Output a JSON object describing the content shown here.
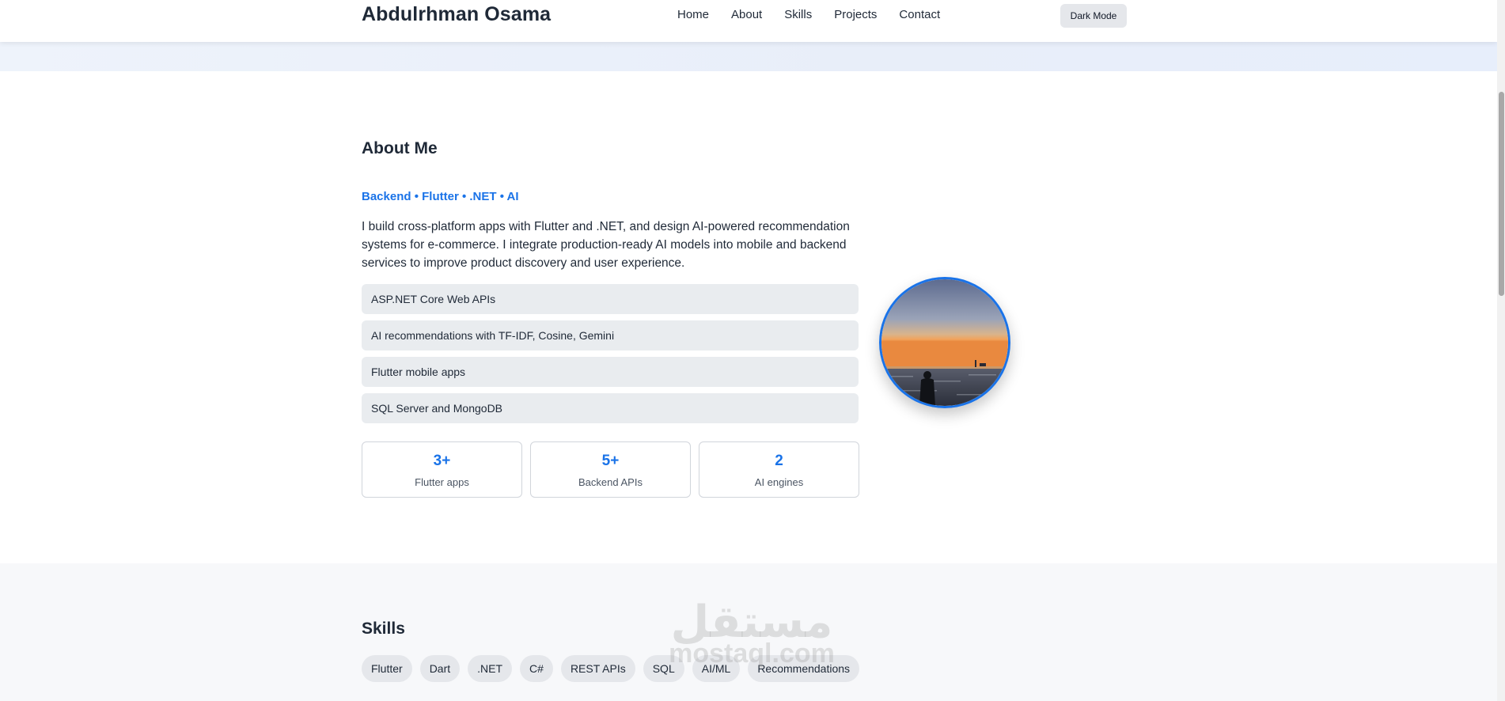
{
  "header": {
    "brand": "Abdulrhman Osama",
    "nav": [
      "Home",
      "About",
      "Skills",
      "Projects",
      "Contact"
    ],
    "theme_toggle": "Dark Mode"
  },
  "about": {
    "title": "About Me",
    "tagline": "Backend • Flutter • .NET • AI",
    "bio": "I build cross-platform apps with Flutter and .NET, and design AI-powered recommendation systems for e-commerce. I integrate production-ready AI models into mobile and backend services to improve product discovery and user experience.",
    "highlights": [
      "ASP.NET Core Web APIs",
      "AI recommendations with TF-IDF, Cosine, Gemini",
      "Flutter mobile apps",
      "SQL Server and MongoDB"
    ],
    "stats": [
      {
        "value": "3+",
        "label": "Flutter apps"
      },
      {
        "value": "5+",
        "label": "Backend APIs"
      },
      {
        "value": "2",
        "label": "AI engines"
      }
    ]
  },
  "skills": {
    "title": "Skills",
    "items": [
      "Flutter",
      "Dart",
      ".NET",
      "C#",
      "REST APIs",
      "SQL",
      "AI/ML",
      "Recommendations"
    ]
  },
  "watermark": {
    "main": "مستقل",
    "sub": "mostaql.com"
  },
  "colors": {
    "accent": "#1a73e8",
    "text": "#1f2937",
    "chip_bg": "#e5e7eb"
  }
}
